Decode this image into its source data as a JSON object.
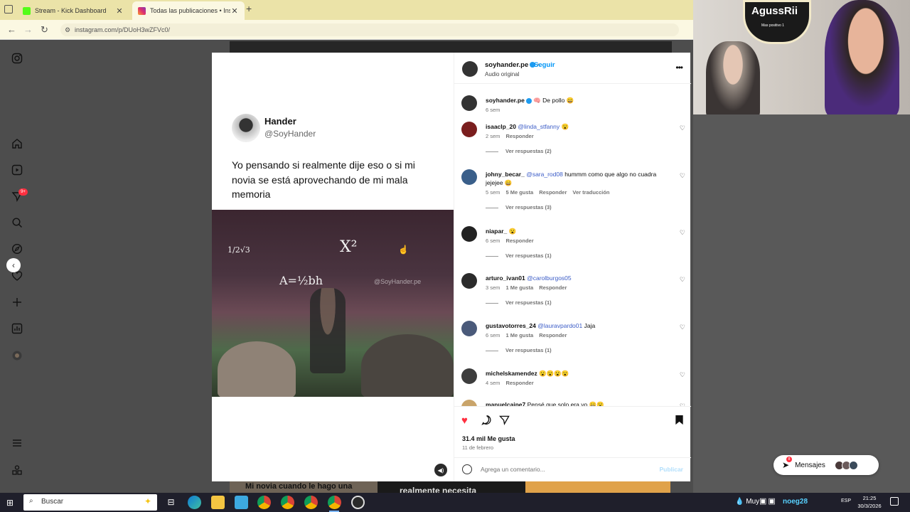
{
  "browser": {
    "tabs": [
      {
        "label": "Stream - Kick Dashboard",
        "favicon_color": "#53fc18"
      },
      {
        "label": "Todas las publicaciones • Insta",
        "favicon_color": "#e1306c"
      }
    ],
    "url": "instagram.com/p/DUoH3wZFVc0/"
  },
  "post": {
    "author": "soyhander.pe",
    "follow_label": "Seguir",
    "audio_label": "Audio original",
    "more_label": "•••",
    "tweet": {
      "name": "Hander",
      "handle": "@SoyHander",
      "text": "Yo pensando si realmente dije eso o si mi novia se está aprovechando de mi mala memoria"
    },
    "video": {
      "equation_1": "X²",
      "equation_2": "A=½bh",
      "equation_3": "1/2√3",
      "watermark": "@SoyHander.pe"
    },
    "caption": {
      "user": "soyhander.pe",
      "text": "🧠 De pollo 😄",
      "time": "6 sem"
    },
    "comments": [
      {
        "user": "isaaclp_20",
        "mention": "@linda_stfanny",
        "text": "😮",
        "time": "2 sem",
        "likes": "",
        "reply": "Responder",
        "translate": "",
        "replies": "Ver respuestas (2)",
        "avatar_color": "#7a1e1e"
      },
      {
        "user": "johny_becar_",
        "mention": "@sara_rod08",
        "text": "hummm como que algo no cuadra jejejee 😄",
        "time": "5 sem",
        "likes": "5 Me gusta",
        "reply": "Responder",
        "translate": "Ver traducción",
        "replies": "Ver respuestas (3)",
        "avatar_color": "#3a5f8a"
      },
      {
        "user": "niapar_",
        "mention": "",
        "text": "😮",
        "time": "6 sem",
        "likes": "",
        "reply": "Responder",
        "translate": "",
        "replies": "Ver respuestas (1)",
        "avatar_color": "#222222"
      },
      {
        "user": "arturo_ivan01",
        "mention": "@carolburgos05",
        "text": "",
        "time": "3 sem",
        "likes": "1 Me gusta",
        "reply": "Responder",
        "translate": "",
        "replies": "Ver respuestas (1)",
        "avatar_color": "#2b2b2b"
      },
      {
        "user": "gustavotorres_24",
        "mention": "@lauravpardo01",
        "text": "Jaja",
        "time": "6 sem",
        "likes": "1 Me gusta",
        "reply": "Responder",
        "translate": "",
        "replies": "Ver respuestas (1)",
        "avatar_color": "#4a5a7a"
      },
      {
        "user": "michelskamendez",
        "mention": "",
        "text": "😮😮😮😮",
        "time": "4 sem",
        "likes": "",
        "reply": "Responder",
        "translate": "",
        "replies": "",
        "avatar_color": "#3d3d3d"
      },
      {
        "user": "manuelcaipe7",
        "mention": "",
        "text": "Pensé que solo era yo 😄😮",
        "time": "",
        "likes": "",
        "reply": "",
        "translate": "",
        "replies": "",
        "avatar_color": "#c9a46a"
      }
    ],
    "likes_count": "31.4 mil Me gusta",
    "date": "11 de febrero",
    "comment_placeholder": "Agrega un comentario...",
    "publish_label": "Publicar"
  },
  "behind_text": {
    "left": "Mi novia cuando le hago una",
    "right": "realmente necesita"
  },
  "webcam": {
    "sign_title": "AgussRii",
    "sign_sub": "Mas positivo 1"
  },
  "messages": {
    "label": "Mensajes",
    "badge": "8"
  },
  "taskbar": {
    "search_placeholder": "Buscar",
    "weather": "Muy",
    "user_tag": "noeg28",
    "lang": "ESP",
    "time": "21:25",
    "date": "30/3/2026"
  },
  "sidebar": {
    "notification_badge": "9+"
  },
  "colors": {
    "like_red": "#ff3040",
    "link_blue": "#0095f6",
    "mention_blue": "#3b5cc7"
  }
}
